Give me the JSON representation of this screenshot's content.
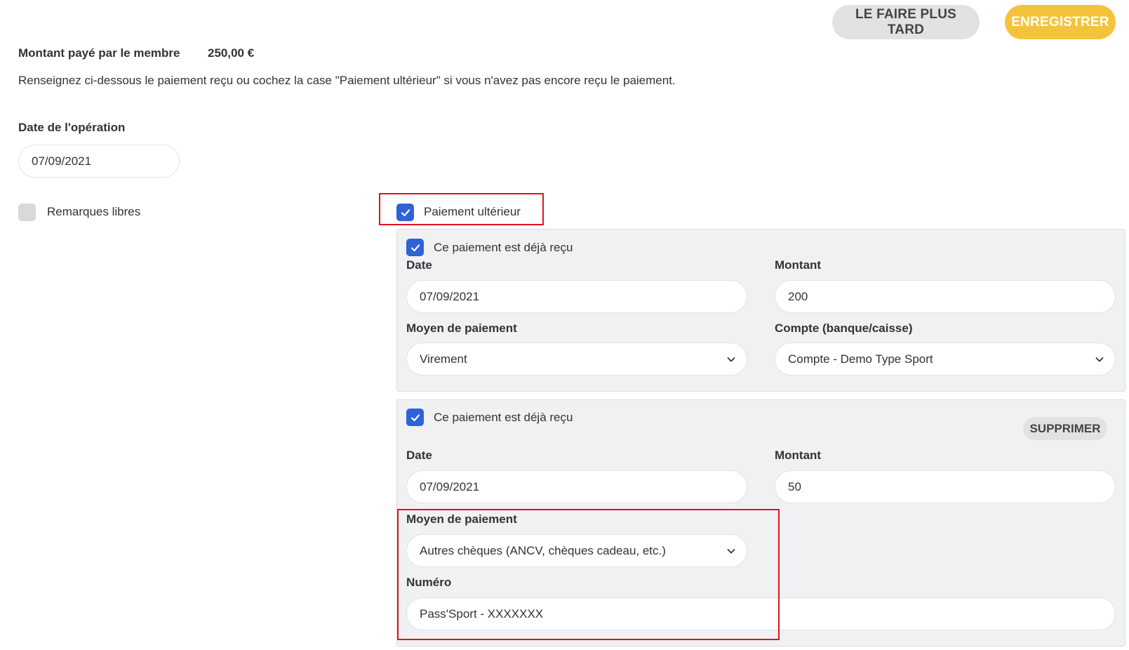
{
  "actions": {
    "later_label": "LE FAIRE PLUS TARD",
    "save_label": "ENREGISTRER"
  },
  "summary": {
    "amount_label": "Montant payé par le membre",
    "amount_value": "250,00 €",
    "instruction": "Renseignez ci-dessous le paiement reçu ou cochez la case \"Paiement ultérieur\" si vous n'avez pas encore reçu le paiement."
  },
  "operation": {
    "date_label": "Date de l'opération",
    "date_value": "07/09/2021"
  },
  "options": {
    "remarks_label": "Remarques libres",
    "remarks_checked": false,
    "later_payment_label": "Paiement ultérieur",
    "later_payment_checked": true
  },
  "payments": [
    {
      "received_label": "Ce paiement est déjà reçu",
      "received_checked": true,
      "date_label": "Date",
      "date_value": "07/09/2021",
      "amount_label": "Montant",
      "amount_value": "200",
      "method_label": "Moyen de paiement",
      "method_value": "Virement",
      "account_label": "Compte (banque/caisse)",
      "account_value": "Compte - Demo Type Sport"
    },
    {
      "received_label": "Ce paiement est déjà reçu",
      "received_checked": true,
      "delete_label": "SUPPRIMER",
      "date_label": "Date",
      "date_value": "07/09/2021",
      "amount_label": "Montant",
      "amount_value": "50",
      "method_label": "Moyen de paiement",
      "method_value": "Autres chèques (ANCV, chèques cadeau, etc.)",
      "number_label": "Numéro",
      "number_value": "Pass'Sport - XXXXXXX"
    }
  ],
  "colors": {
    "accent": "#f5c33b",
    "checkbox": "#2f62d6",
    "highlight": "#e0141e",
    "panel": "#f0f1f2"
  }
}
